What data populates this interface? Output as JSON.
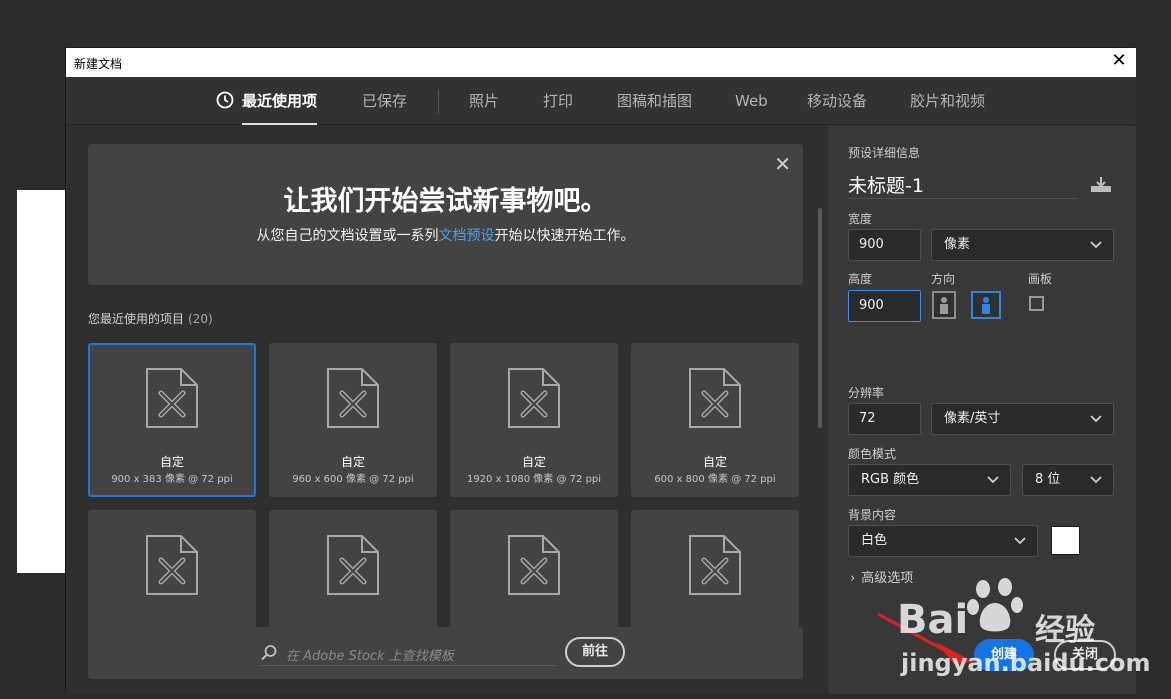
{
  "dialog": {
    "title": "新建文档",
    "close_glyph": "✕"
  },
  "tabs": [
    {
      "label": "最近使用项",
      "active": true,
      "icon": "clock-icon"
    },
    {
      "label": "已保存"
    },
    {
      "label": "照片"
    },
    {
      "label": "打印"
    },
    {
      "label": "图稿和插图"
    },
    {
      "label": "Web"
    },
    {
      "label": "移动设备"
    },
    {
      "label": "胶片和视频"
    }
  ],
  "banner": {
    "heading": "让我们开始尝试新事物吧。",
    "text_before": "从您自己的文档设置或一系列",
    "link": "文档预设",
    "text_after": "开始以快速开始工作。",
    "close_glyph": "✕"
  },
  "recent": {
    "label": "您最近使用的项目",
    "count": "(20)",
    "items": [
      {
        "name": "自定",
        "size": "900 x 383 像素 @ 72 ppi",
        "selected": true
      },
      {
        "name": "自定",
        "size": "960 x 600 像素 @ 72 ppi"
      },
      {
        "name": "自定",
        "size": "1920 x 1080 像素 @ 72 ppi"
      },
      {
        "name": "自定",
        "size": "600 x 800 像素 @ 72 ppi"
      },
      {
        "name": "",
        "size": ""
      },
      {
        "name": "",
        "size": ""
      },
      {
        "name": "",
        "size": ""
      },
      {
        "name": "",
        "size": ""
      }
    ]
  },
  "stock": {
    "placeholder": "在 Adobe Stock 上查找模板",
    "go_label": "前往"
  },
  "preset": {
    "section_label": "预设详细信息",
    "doc_name": "未标题-1",
    "width_label": "宽度",
    "width": "900",
    "width_unit": "像素",
    "height_label": "高度",
    "height": "900",
    "orientation_label": "方向",
    "artboard_label": "画板",
    "resolution_label": "分辨率",
    "resolution": "72",
    "resolution_unit": "像素/英寸",
    "color_mode_label": "颜色模式",
    "color_mode": "RGB 颜色",
    "bit_depth": "8 位",
    "background_label": "背景内容",
    "background": "白色",
    "background_color": "#ffffff",
    "advanced_label": "高级选项"
  },
  "buttons": {
    "create": "创建",
    "close": "关闭"
  },
  "watermark": {
    "brand": "Bai",
    "brand_suffix": "经验",
    "url": "jingyan.baidu.com"
  },
  "colors": {
    "accent": "#1473e6",
    "link": "#4f9ff0"
  }
}
